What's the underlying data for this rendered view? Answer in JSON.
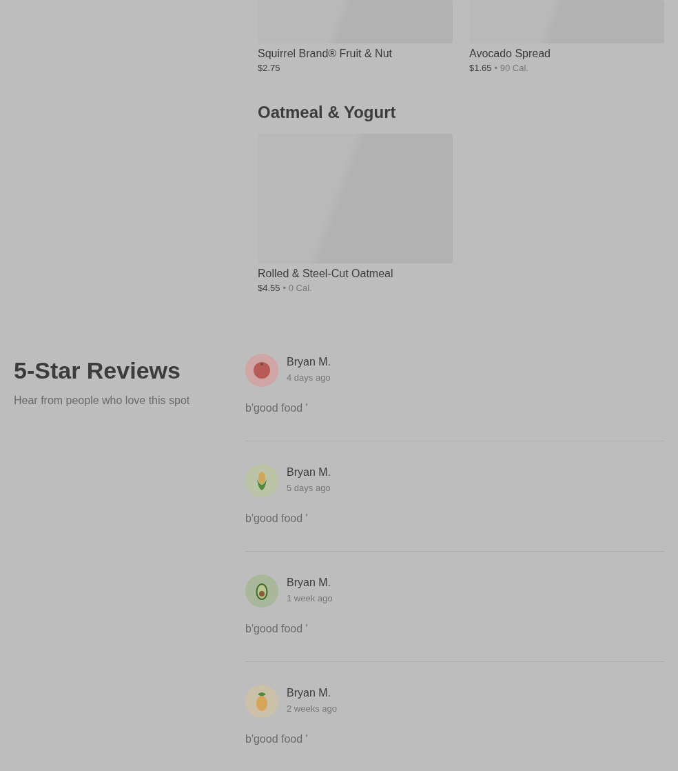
{
  "menu_sections": [
    {
      "items": [
        {
          "name": "Squirrel Brand® Fruit & Nut",
          "price": "$2.75"
        },
        {
          "name": "Avocado Spread",
          "price": "$1.65",
          "separator": "•",
          "calories": "90 Cal."
        }
      ]
    },
    {
      "title": "Oatmeal & Yogurt",
      "items": [
        {
          "name": "Rolled & Steel-Cut Oatmeal",
          "price": "$4.55",
          "separator": "•",
          "calories": "0 Cal."
        }
      ]
    }
  ],
  "reviews_section": {
    "title": "5-Star Reviews",
    "subtitle": "Hear from people who love this spot",
    "reviews": [
      {
        "kind": "tomato",
        "author": "Bryan M.",
        "time": "4 days ago",
        "text": "b'good food '"
      },
      {
        "kind": "corn",
        "author": "Bryan M.",
        "time": "5 days ago",
        "text": "b'good food '"
      },
      {
        "kind": "avocado",
        "author": "Bryan M.",
        "time": "1 week ago",
        "text": "b'good food '"
      },
      {
        "kind": "pineapple",
        "author": "Bryan M.",
        "time": "2 weeks ago",
        "text": "b'good food '"
      }
    ]
  }
}
